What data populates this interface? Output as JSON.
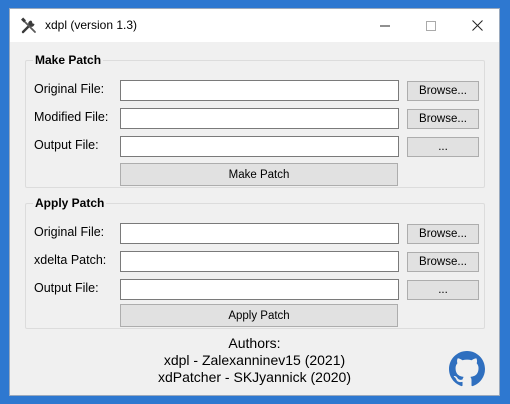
{
  "window": {
    "title": "xdpl (version 1.3)",
    "controls": {
      "minimize": "—",
      "maximize": "☐",
      "close": "✕"
    }
  },
  "make_patch": {
    "title": "Make Patch",
    "rows": [
      {
        "label": "Original File:",
        "value": "",
        "button": "Browse..."
      },
      {
        "label": "Modified File:",
        "value": "",
        "button": "Browse..."
      },
      {
        "label": "Output File:",
        "value": "",
        "button": "..."
      }
    ],
    "action": "Make Patch"
  },
  "apply_patch": {
    "title": "Apply Patch",
    "rows": [
      {
        "label": "Original File:",
        "value": "",
        "button": "Browse..."
      },
      {
        "label": "xdelta Patch:",
        "value": "",
        "button": "Browse..."
      },
      {
        "label": "Output File:",
        "value": "",
        "button": "..."
      }
    ],
    "action": "Apply Patch"
  },
  "authors": {
    "heading": "Authors:",
    "lines": [
      "xdpl - Zalexanninev15 (2021)",
      "xdPatcher - SKJyannick (2020)"
    ]
  },
  "icons": {
    "app": "tools-icon",
    "github": "github-icon"
  },
  "colors": {
    "desktop": "#2e78d0",
    "window": "#f0f0f0",
    "github": "#2f6fbf"
  }
}
